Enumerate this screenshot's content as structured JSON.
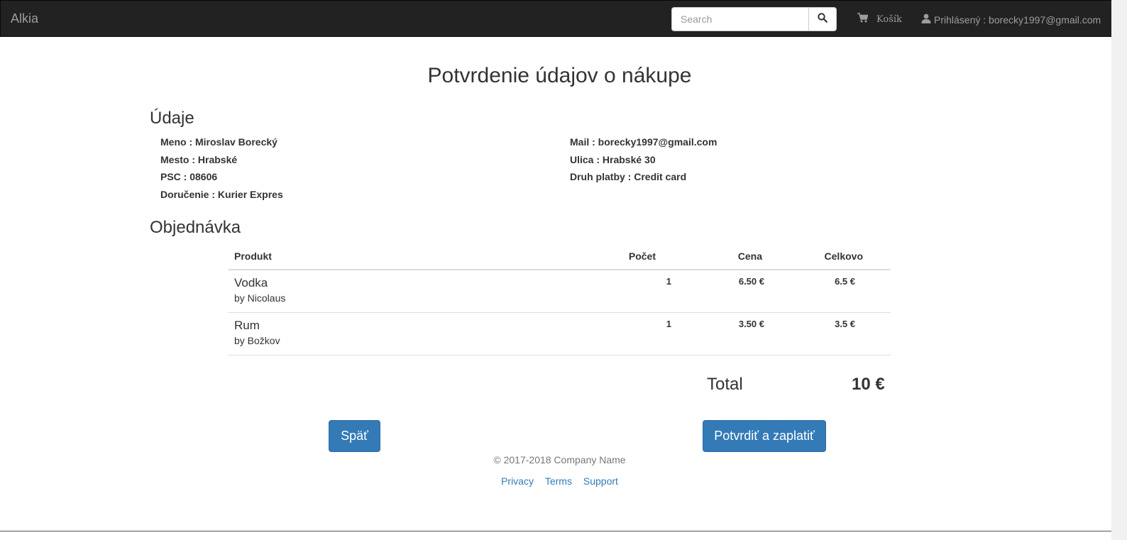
{
  "navbar": {
    "brand": "Alkia",
    "search_placeholder": "Search",
    "search_icon": "magnifier-icon",
    "cart_icon": "shopping-cart-icon",
    "cart_label": "Košík",
    "user_icon": "user-icon",
    "user_label": "Prihlásený : borecky1997@gmail.com"
  },
  "page": {
    "title": "Potvrdenie údajov o nákupe"
  },
  "details": {
    "heading": "Údaje",
    "name": "Meno : Miroslav Borecký",
    "city": "Mesto : Hrabské",
    "zip": "PSC : 08606",
    "delivery": "Doručenie : Kurier Expres",
    "mail": "Mail : borecky1997@gmail.com",
    "street": "Ulica : Hrabské 30",
    "payment": "Druh platby : Credit card"
  },
  "order": {
    "heading": "Objednávka",
    "columns": [
      "Produkt",
      "Počet",
      "Cena",
      "Celkovo"
    ],
    "rows": [
      {
        "name": "Vodka",
        "brand": "by Nicolaus",
        "qty": "1",
        "price": "6.50 €",
        "total": "6.5 €"
      },
      {
        "name": "Rum",
        "brand": "by Božkov",
        "qty": "1",
        "price": "3.50 €",
        "total": "3.5 €"
      }
    ],
    "total_label": "Total",
    "total_value": "10 €"
  },
  "actions": {
    "back_label": "Späť",
    "confirm_label": "Potvrdiť a zaplatiť",
    "primary_color": "#337ab7"
  },
  "footer": {
    "copyright": "© 2017-2018 Company Name",
    "links": [
      "Privacy",
      "Terms",
      "Support"
    ]
  }
}
